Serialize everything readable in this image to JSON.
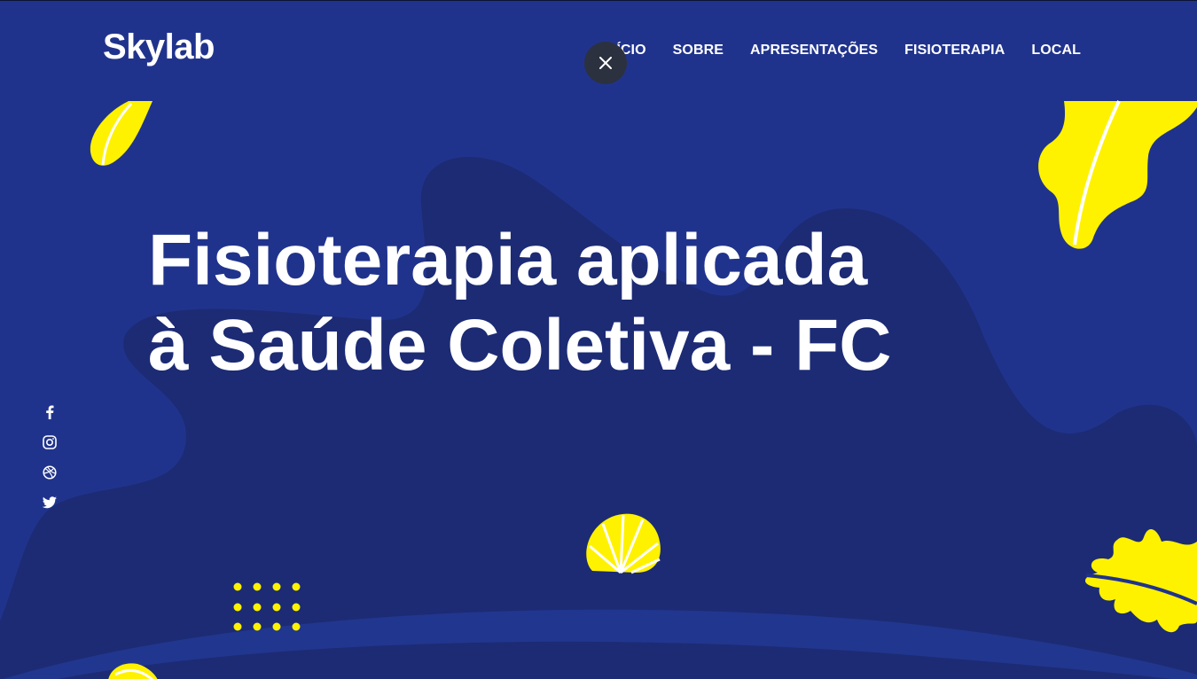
{
  "header": {
    "logo": "Skylab",
    "nav": [
      {
        "label": "INÍCIO"
      },
      {
        "label": "SOBRE"
      },
      {
        "label": "APRESENTAÇÕES"
      },
      {
        "label": "FISIOTERAPIA"
      },
      {
        "label": "LOCAL"
      }
    ]
  },
  "hero": {
    "title_line1": "Fisioterapia aplicada",
    "title_line2": "à Saúde Coletiva - FC"
  },
  "social": [
    {
      "icon": "facebook-icon"
    },
    {
      "icon": "instagram-icon"
    },
    {
      "icon": "dribbble-icon"
    },
    {
      "icon": "twitter-icon"
    }
  ],
  "colors": {
    "background": "#20338c",
    "blob": "#1c2b74",
    "accent_yellow": "#fff200",
    "text": "#ffffff",
    "close_button": "#2c3140"
  }
}
